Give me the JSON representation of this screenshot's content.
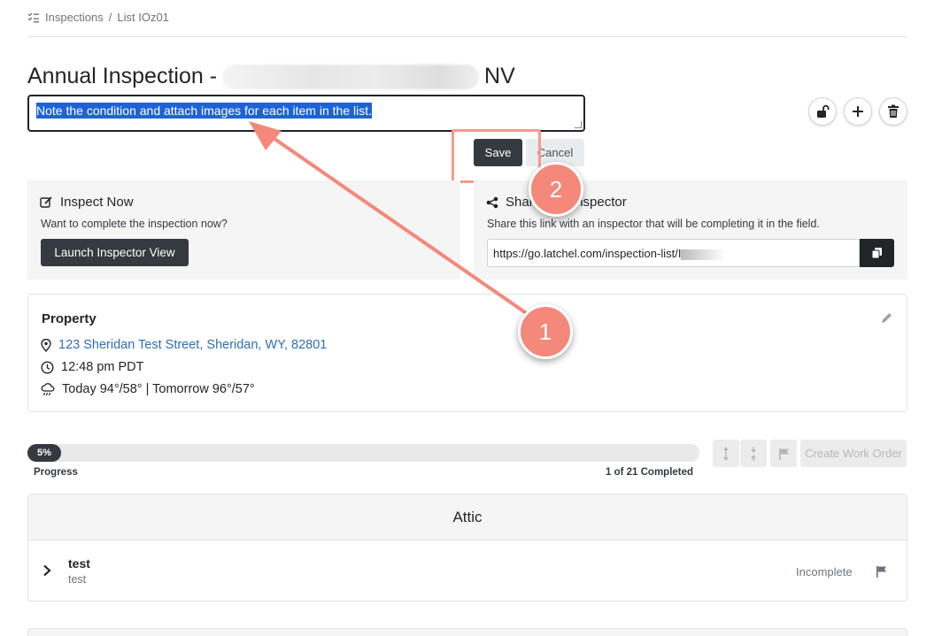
{
  "breadcrumb": {
    "root": "Inspections",
    "separator": "/",
    "current": "List IOz01"
  },
  "page": {
    "title_prefix": "Annual Inspection -",
    "title_suffix": "NV"
  },
  "description": {
    "value": "Note the condition and attach images for each item in the list."
  },
  "edit_actions": {
    "save_label": "Save",
    "cancel_label": "Cancel"
  },
  "inspect_now": {
    "title": "Inspect Now",
    "subtitle": "Want to complete the inspection now?",
    "button_label": "Launch Inspector View"
  },
  "share": {
    "title": "Share with Inspector",
    "subtitle": "Share this link with an inspector that will be completing it in the field.",
    "link_value": "https://go.latchel.com/inspection-list/I"
  },
  "property": {
    "heading": "Property",
    "address": "123 Sheridan Test Street, Sheridan, WY, 82801",
    "time": "12:48 pm PDT",
    "weather": "Today 94°/58° | Tomorrow 96°/57°"
  },
  "progress": {
    "percent_label": "5%",
    "percent": 5,
    "label": "Progress",
    "completed_text": "1 of 21 Completed"
  },
  "toolbar": {
    "create_work_order_label": "Create Work Order"
  },
  "section": {
    "name": "Attic",
    "items": [
      {
        "title": "test",
        "subtitle": "test",
        "status": "Incomplete"
      }
    ]
  },
  "annotations": {
    "badge_1": "1",
    "badge_2": "2"
  },
  "colors": {
    "annotation": "#f4887a",
    "link": "#2f6fb5",
    "dark_button": "#343a40",
    "selection": "#1e63d6"
  },
  "icons": [
    "checklist-icon",
    "edit-icon",
    "share-icon",
    "copy-icon",
    "map-pin-icon",
    "clock-icon",
    "rain-cloud-icon",
    "pencil-icon",
    "unlock-icon",
    "plus-icon",
    "trash-icon",
    "expand-all-icon",
    "collapse-all-icon",
    "flag-icon",
    "chevron-right-icon"
  ]
}
